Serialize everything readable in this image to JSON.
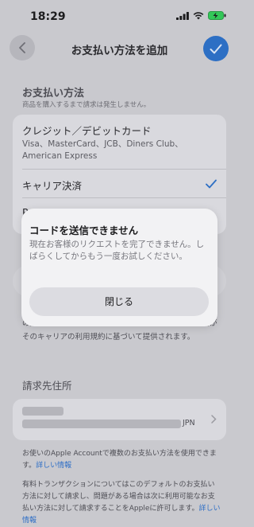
{
  "status_bar": {
    "time": "18:29"
  },
  "nav": {
    "title": "お支払い方法を追加"
  },
  "payment_section": {
    "title": "お支払い方法",
    "note": "商品を購入するまで請求は発生しません。"
  },
  "payment_options": [
    {
      "title": "クレジット／デビットカード",
      "subtitle": "Visa、MasterCard、JCB、Diners Club、American Express"
    },
    {
      "title": "キャリア決済",
      "selected": true
    },
    {
      "title": "PayPay"
    }
  ],
  "carrier_notice": "の携帯電話に送信されます。続行すると、キャリア決済がそのキャリアの利用規約に基づいて提供されます。",
  "billing": {
    "title": "請求先住所",
    "country": "JPN"
  },
  "footer": {
    "text1": "お使いのApple Accountで複数のお支払い方法を使用できます。",
    "link1": "詳しい情報",
    "text2": "有料トランザクションについてはこのデフォルトのお支払い方法に対して請求し、問題がある場合は次に利用可能なお支払い方法に対して請求することをAppleに許可します。",
    "link2": "詳しい情報"
  },
  "dialog": {
    "title": "コードを送信できません",
    "message": "現在お客様のリクエストを完了できません。しばらくしてからもう一度お試しください。",
    "button": "閉じる"
  },
  "colors": {
    "accent": "#2d6fc4",
    "battery": "#34c759",
    "overlay": "#c9c9ce"
  }
}
